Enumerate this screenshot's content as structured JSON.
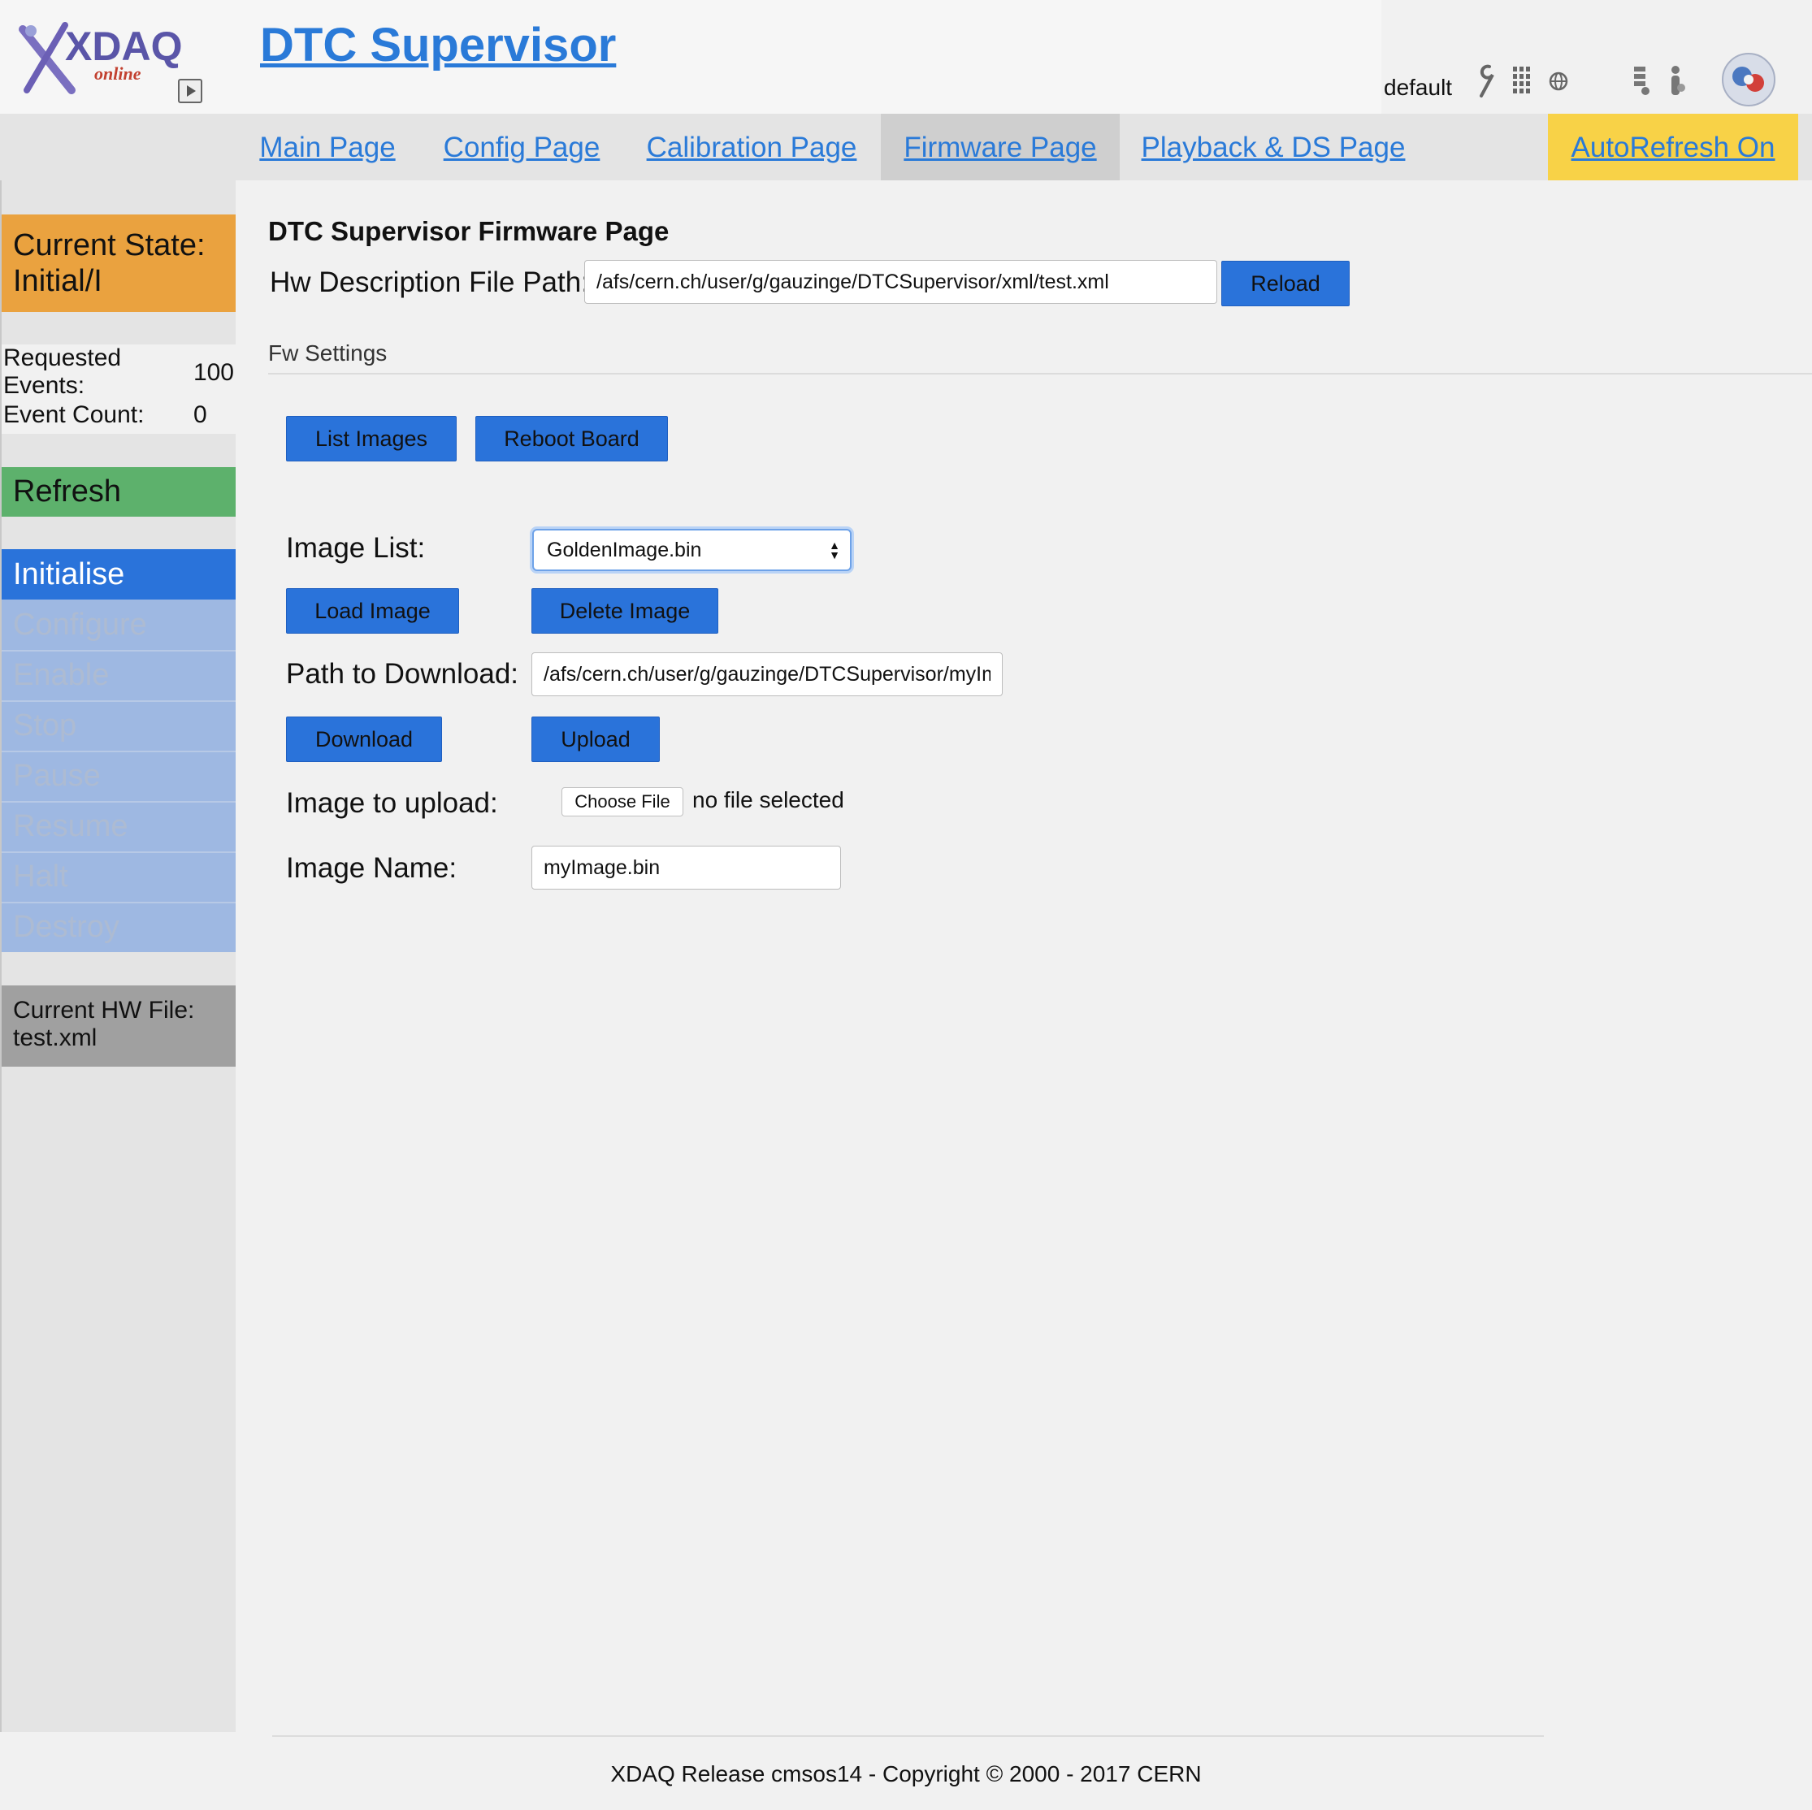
{
  "header": {
    "logo_text": "XDAQ",
    "logo_subtext": "online",
    "app_title": "DTC Supervisor",
    "user": "default"
  },
  "nav": {
    "tabs": [
      {
        "label": "Main Page"
      },
      {
        "label": "Config Page"
      },
      {
        "label": "Calibration Page"
      },
      {
        "label": "Firmware Page",
        "active": true
      },
      {
        "label": "Playback & DS Page"
      }
    ],
    "autorefresh_label": "AutoRefresh On"
  },
  "sidebar": {
    "state_label": "Current State:",
    "state_value": "Initial/I",
    "requested_events_label_1": "Requested",
    "requested_events_label_2": "Events:",
    "requested_events_value": "100",
    "event_count_label": "Event Count:",
    "event_count_value": "0",
    "refresh_label": "Refresh",
    "commands": [
      "Initialise",
      "Configure",
      "Enable",
      "Stop",
      "Pause",
      "Resume",
      "Halt",
      "Destroy"
    ],
    "hwfile_label": "Current HW File:",
    "hwfile_value": "test.xml"
  },
  "main": {
    "heading": "DTC Supervisor Firmware Page",
    "hw_path_label": "Hw Description File Path:",
    "hw_path_value": "/afs/cern.ch/user/g/gauzinge/DTCSupervisor/xml/test.xml",
    "reload_label": "Reload",
    "fw_settings_label": "Fw Settings",
    "list_images_label": "List Images",
    "reboot_board_label": "Reboot Board",
    "image_list_label": "Image List:",
    "image_list_selected": "GoldenImage.bin",
    "load_image_label": "Load Image",
    "delete_image_label": "Delete Image",
    "path_download_label": "Path to Download:",
    "path_download_value": "/afs/cern.ch/user/g/gauzinge/DTCSupervisor/myIma",
    "download_label": "Download",
    "upload_label": "Upload",
    "image_upload_label": "Image to upload:",
    "choose_file_label": "Choose File",
    "no_file_label": "no file selected",
    "image_name_label": "Image Name:",
    "image_name_value": "myImage.bin"
  },
  "footer": {
    "text": "XDAQ Release cmsos14 - Copyright © 2000 - 2017 CERN"
  },
  "colors": {
    "accent_blue": "#2a73da",
    "state_orange": "#eaa23f",
    "refresh_green": "#5db16c",
    "autorefresh_yellow": "#f8d247"
  }
}
